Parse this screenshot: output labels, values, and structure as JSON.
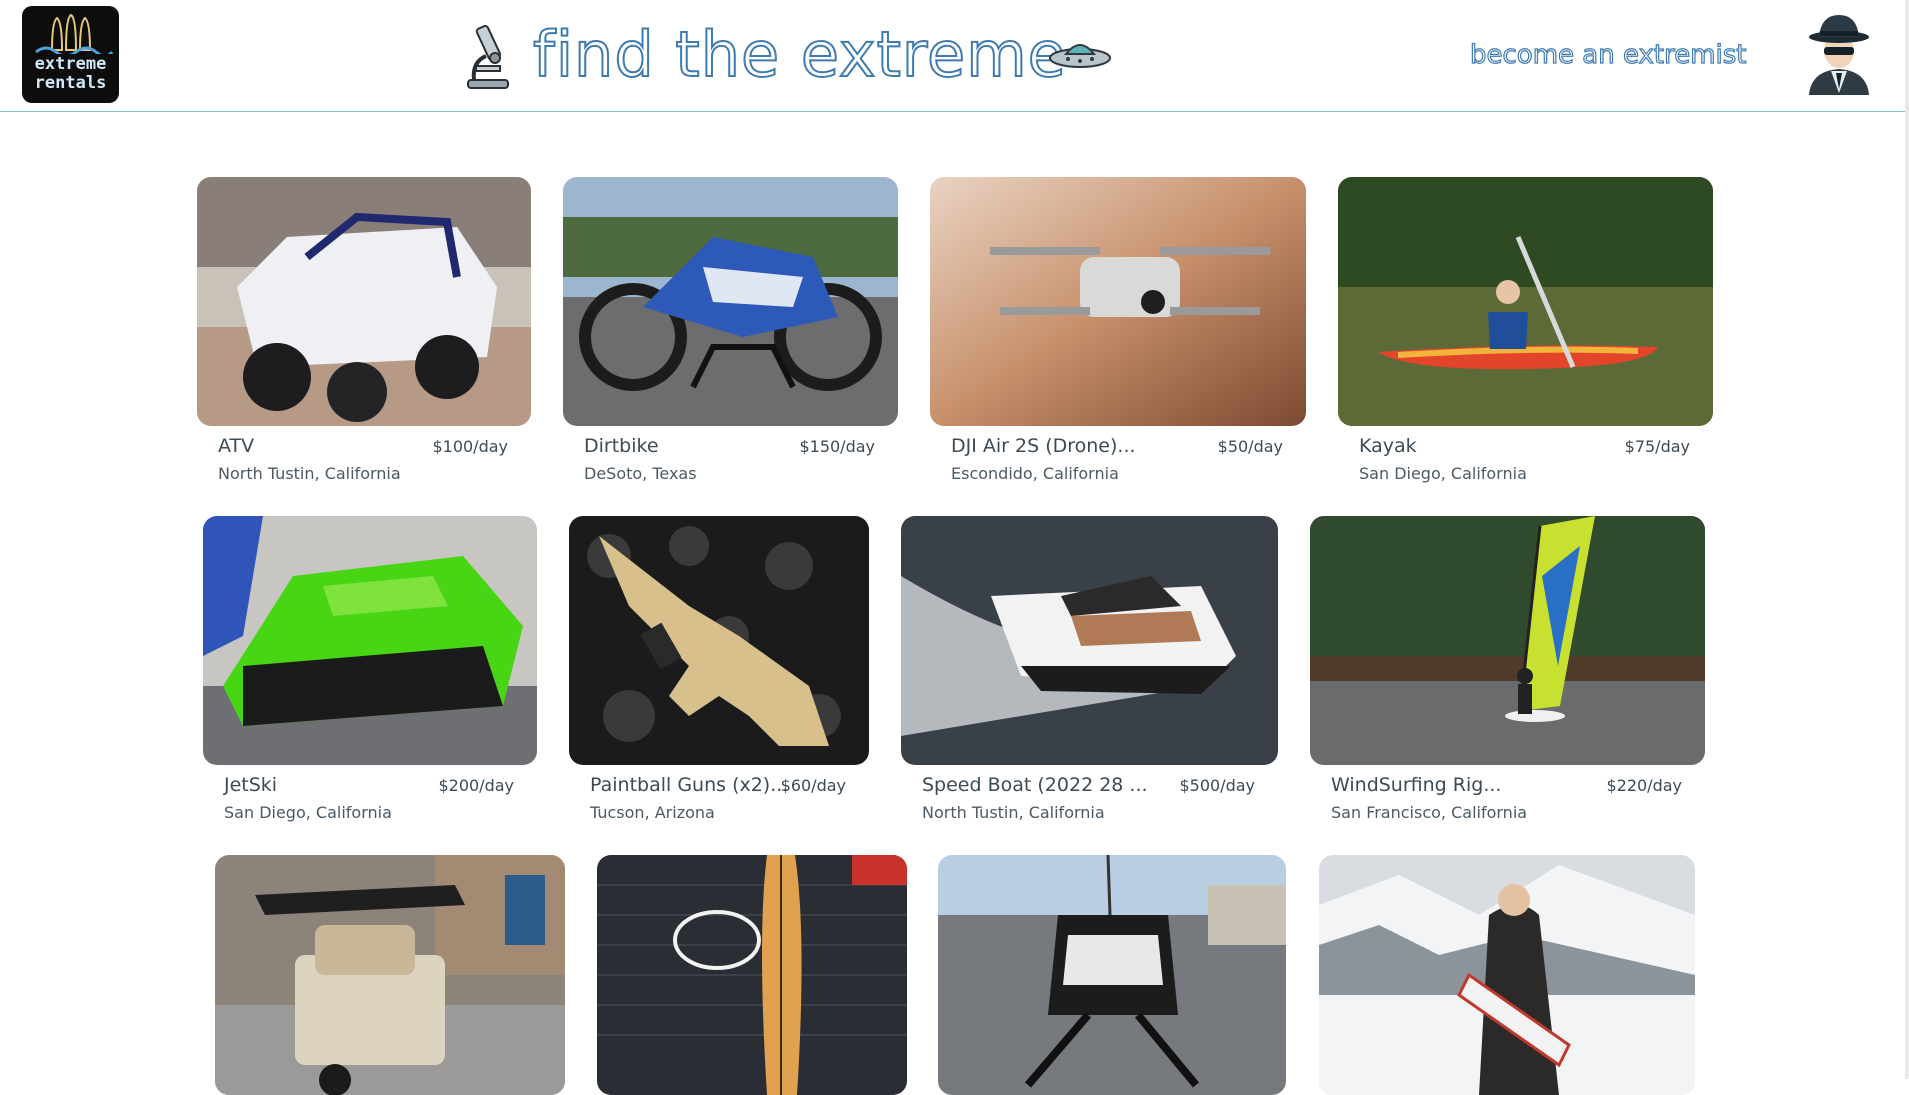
{
  "header": {
    "logo_line1": "extreme",
    "logo_line2": "rentals",
    "title": "find the extreme",
    "become_link": "become an extremist"
  },
  "listings": [
    {
      "name": "ATV",
      "price": "$100/day",
      "location": "North Tustin, California"
    },
    {
      "name": "Dirtbike",
      "price": "$150/day",
      "location": "DeSoto, Texas"
    },
    {
      "name": "DJI Air 2S (Drone)...",
      "price": "$50/day",
      "location": "Escondido, California"
    },
    {
      "name": "Kayak",
      "price": "$75/day",
      "location": "San Diego, California"
    },
    {
      "name": "JetSki",
      "price": "$200/day",
      "location": "San Diego, California"
    },
    {
      "name": "Paintball Guns (x2)...",
      "price": "$60/day",
      "location": "Tucson, Arizona"
    },
    {
      "name": "Speed Boat (2022 28 ...",
      "price": "$500/day",
      "location": "North Tustin, California"
    },
    {
      "name": "WindSurfing Rig...",
      "price": "$220/day",
      "location": "San Francisco, California"
    },
    {
      "name": "",
      "price": "",
      "location": ""
    },
    {
      "name": "",
      "price": "",
      "location": ""
    },
    {
      "name": "",
      "price": "",
      "location": ""
    },
    {
      "name": "",
      "price": "",
      "location": ""
    }
  ],
  "icons": {
    "logo": "surfboards-logo-icon",
    "microscope": "microscope-icon",
    "ufo": "flying-saucer-icon",
    "avatar": "spy-avatar-icon"
  },
  "colors": {
    "accent": "#3f7ab0",
    "divider": "#7fc8c4",
    "text": "#3d4b55"
  }
}
